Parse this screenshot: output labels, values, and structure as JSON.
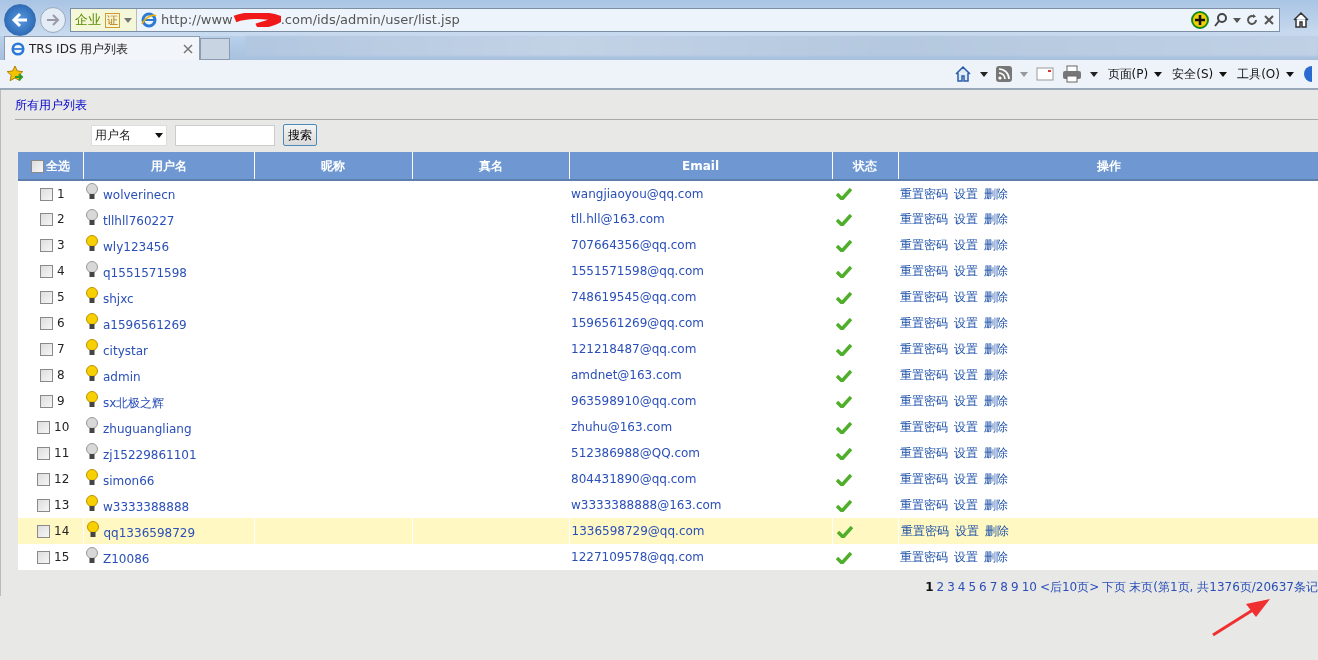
{
  "browser": {
    "address_start": "http://www",
    "address_end": ".com/ids/admin/user/list.jsp",
    "site_badge": "企业",
    "cert_badge": "证",
    "tab_title": "TRS IDS 用户列表",
    "tab_selected": true,
    "menus": [
      "页面(P)",
      "安全(S)",
      "工具(O)"
    ]
  },
  "page": {
    "heading": "所有用户列表",
    "search": {
      "field_select": "用户名",
      "button": "搜索"
    },
    "table": {
      "select_all_checked": false,
      "columns": [
        "全选",
        "用户名",
        "昵称",
        "真名",
        "Email",
        "状态",
        "操作"
      ],
      "rows": [
        {
          "no": "1",
          "username": "wolverinecn",
          "email": "wangjiaoyou@qq.com",
          "online": false,
          "enabled": true,
          "checked": false,
          "highlighted": false,
          "actions": [
            "重置密码",
            "设置",
            "删除"
          ]
        },
        {
          "no": "2",
          "username": "tllhll760227",
          "email": "tll.hll@163.com",
          "online": false,
          "enabled": true,
          "checked": false,
          "highlighted": false,
          "actions": [
            "重置密码",
            "设置",
            "删除"
          ]
        },
        {
          "no": "3",
          "username": "wly123456",
          "email": "707664356@qq.com",
          "online": true,
          "enabled": true,
          "checked": false,
          "highlighted": false,
          "actions": [
            "重置密码",
            "设置",
            "删除"
          ]
        },
        {
          "no": "4",
          "username": "q1551571598",
          "email": "1551571598@qq.com",
          "online": false,
          "enabled": true,
          "checked": false,
          "highlighted": false,
          "actions": [
            "重置密码",
            "设置",
            "删除"
          ]
        },
        {
          "no": "5",
          "username": "shjxc",
          "email": "748619545@qq.com",
          "online": true,
          "enabled": true,
          "checked": false,
          "highlighted": false,
          "actions": [
            "重置密码",
            "设置",
            "删除"
          ]
        },
        {
          "no": "6",
          "username": "a1596561269",
          "email": "1596561269@qq.com",
          "online": true,
          "enabled": true,
          "checked": false,
          "highlighted": false,
          "actions": [
            "重置密码",
            "设置",
            "删除"
          ]
        },
        {
          "no": "7",
          "username": "citystar",
          "email": "121218487@qq.com",
          "online": true,
          "enabled": true,
          "checked": false,
          "highlighted": false,
          "actions": [
            "重置密码",
            "设置",
            "删除"
          ]
        },
        {
          "no": "8",
          "username": "admin",
          "email": "amdnet@163.com",
          "online": true,
          "enabled": true,
          "checked": false,
          "highlighted": false,
          "actions": [
            "重置密码",
            "设置",
            "删除"
          ]
        },
        {
          "no": "9",
          "username": "sx北极之辉",
          "email": "963598910@qq.com",
          "online": true,
          "enabled": true,
          "checked": false,
          "highlighted": false,
          "actions": [
            "重置密码",
            "设置",
            "删除"
          ]
        },
        {
          "no": "10",
          "username": "zhuguangliang",
          "email": "zhuhu@163.com",
          "online": false,
          "enabled": true,
          "checked": false,
          "highlighted": false,
          "actions": [
            "重置密码",
            "设置",
            "删除"
          ]
        },
        {
          "no": "11",
          "username": "zj15229861101",
          "email": "512386988@QQ.com",
          "online": false,
          "enabled": true,
          "checked": false,
          "highlighted": false,
          "actions": [
            "重置密码",
            "设置",
            "删除"
          ]
        },
        {
          "no": "12",
          "username": "simon66",
          "email": "804431890@qq.com",
          "online": true,
          "enabled": true,
          "checked": false,
          "highlighted": false,
          "actions": [
            "重置密码",
            "设置",
            "删除"
          ]
        },
        {
          "no": "13",
          "username": "w3333388888",
          "email": "w3333388888@163.com",
          "online": true,
          "enabled": true,
          "checked": false,
          "highlighted": false,
          "actions": [
            "重置密码",
            "设置",
            "删除"
          ]
        },
        {
          "no": "14",
          "username": "qq1336598729",
          "email": "1336598729@qq.com",
          "online": true,
          "enabled": true,
          "checked": false,
          "highlighted": true,
          "actions": [
            "重置密码",
            "设置",
            "删除"
          ]
        },
        {
          "no": "15",
          "username": "Z10086",
          "email": "1227109578@qq.com",
          "online": false,
          "enabled": true,
          "checked": false,
          "highlighted": false,
          "actions": [
            "重置密码",
            "设置",
            "删除"
          ]
        }
      ]
    },
    "pagination": {
      "pages": [
        {
          "label": "1",
          "selected": true
        },
        {
          "label": "2",
          "selected": false
        },
        {
          "label": "3",
          "selected": false
        },
        {
          "label": "4",
          "selected": false
        },
        {
          "label": "5",
          "selected": false
        },
        {
          "label": "6",
          "selected": false
        },
        {
          "label": "7",
          "selected": false
        },
        {
          "label": "8",
          "selected": false
        },
        {
          "label": "9",
          "selected": false
        },
        {
          "label": "10",
          "selected": false
        }
      ],
      "next_ten": "<后10页>",
      "next": "下页",
      "last": "末页",
      "summary": "(第1页, 共1376页/20637条记"
    }
  }
}
